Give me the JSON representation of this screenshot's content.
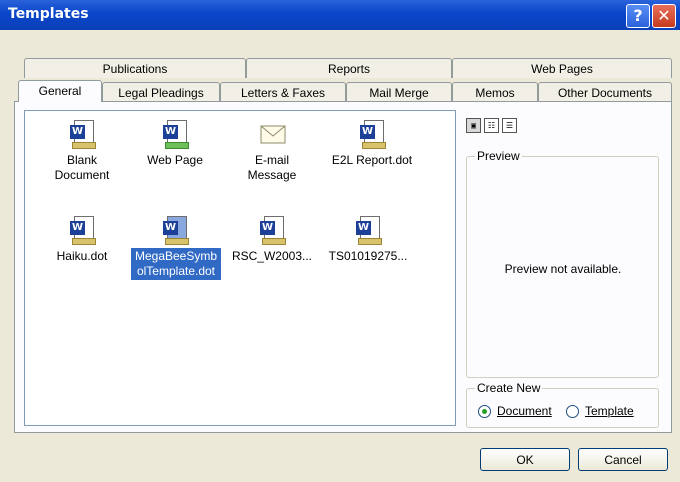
{
  "window": {
    "title": "Templates",
    "help_glyph": "?",
    "close_glyph": "✕"
  },
  "tabs_back": [
    "Publications",
    "Reports",
    "Web Pages"
  ],
  "tabs_front": [
    "General",
    "Legal Pleadings",
    "Letters & Faxes",
    "Mail Merge",
    "Memos",
    "Other Documents"
  ],
  "active_tab": "General",
  "templates": [
    {
      "label": "Blank Document",
      "icon": "word-document-icon"
    },
    {
      "label": "Web Page",
      "icon": "web-page-icon"
    },
    {
      "label": "E-mail Message",
      "icon": "envelope-icon"
    },
    {
      "label": "E2L Report.dot",
      "icon": "word-template-icon"
    },
    {
      "label": "Haiku.dot",
      "icon": "word-template-icon"
    },
    {
      "label": "MegaBeeSymbolTemplate.dot",
      "icon": "word-template-icon",
      "selected": true
    },
    {
      "label": "RSC_W2003...",
      "icon": "word-template-icon"
    },
    {
      "label": "TS01019275...",
      "icon": "word-template-icon"
    }
  ],
  "preview": {
    "legend": "Preview",
    "message": "Preview not available."
  },
  "create_new": {
    "legend": "Create New",
    "document_label": "Document",
    "template_label": "Template",
    "selected": "Document"
  },
  "buttons": {
    "ok": "OK",
    "cancel": "Cancel"
  },
  "colors": {
    "title_bar": "#0a46c9",
    "selection": "#316ac5"
  }
}
